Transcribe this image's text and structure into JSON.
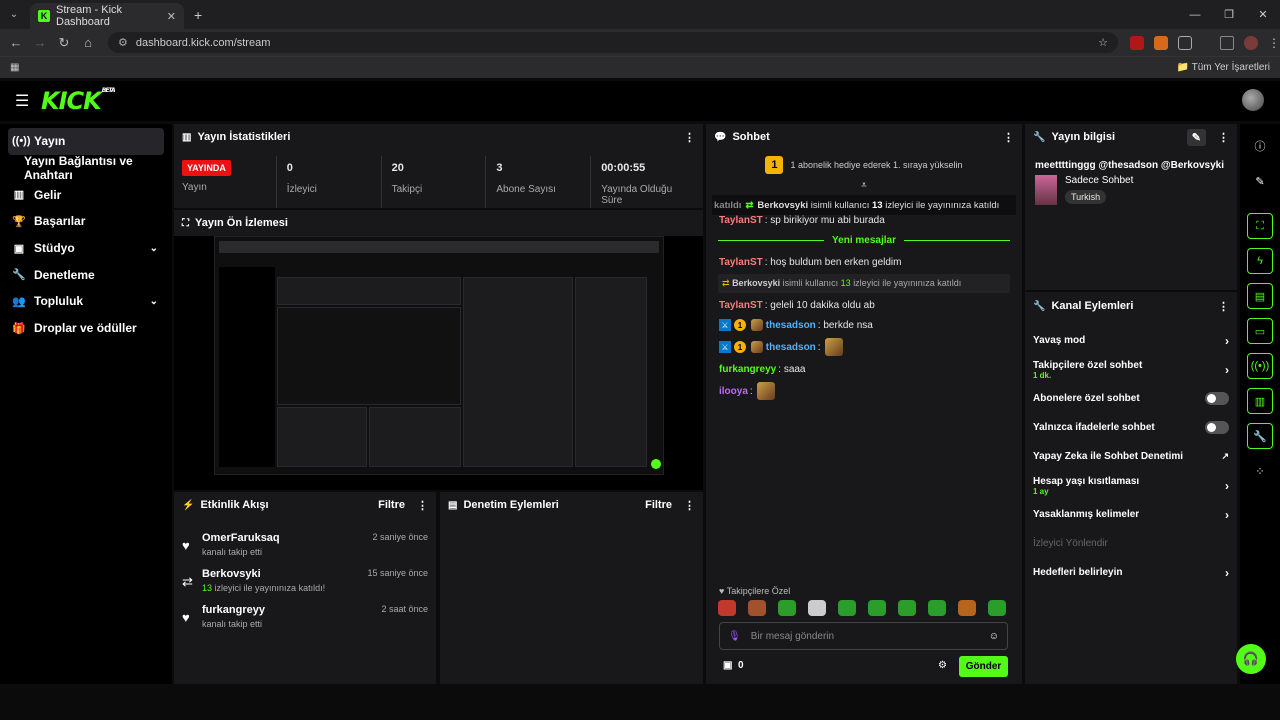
{
  "browser": {
    "tab_title": "Stream - Kick Dashboard",
    "url": "dashboard.kick.com/stream",
    "bookmarks_label": "Tüm Yer İşaretleri"
  },
  "app": {
    "logo": "KICK",
    "logo_badge": "BETA"
  },
  "sidebar": {
    "items": [
      {
        "label": "Yayın",
        "icon": "stream-icon"
      },
      {
        "label": "Yayın Bağlantısı ve Anahtarı"
      },
      {
        "label": "Gelir",
        "icon": "revenue-icon"
      },
      {
        "label": "Başarılar",
        "icon": "trophy-icon"
      },
      {
        "label": "Stüdyo",
        "icon": "studio-icon"
      },
      {
        "label": "Denetleme",
        "icon": "wrench-icon"
      },
      {
        "label": "Topluluk",
        "icon": "community-icon"
      },
      {
        "label": "Droplar ve ödüller",
        "icon": "gift-icon"
      }
    ]
  },
  "stats_panel": {
    "title": "Yayın İstatistikleri",
    "live_badge": "YAYINDA",
    "live_label": "Yayın",
    "viewers": {
      "value": "0",
      "label": "İzleyici"
    },
    "followers": {
      "value": "20",
      "label": "Takipçi"
    },
    "subs": {
      "value": "3",
      "label": "Abone Sayısı"
    },
    "uptime": {
      "value": "00:00:55",
      "label": "Yayında Olduğu Süre"
    }
  },
  "preview_panel": {
    "title": "Yayın Ön İzlemesi"
  },
  "activity_panel": {
    "title": "Etkinlik Akışı",
    "filter": "Filtre",
    "events": [
      {
        "user": "OmerFaruksaq",
        "text": "kanalı takip etti",
        "time": "2 saniye önce",
        "icon": "heart-icon"
      },
      {
        "user": "Berkovsyki",
        "count": "13",
        "text": "izleyici ile yayınınıza katıldı!",
        "time": "15 saniye önce",
        "icon": "raid-icon"
      },
      {
        "user": "furkangreyy",
        "text": "kanalı takip etti",
        "time": "2 saat önce",
        "icon": "heart-icon"
      }
    ]
  },
  "mod_panel": {
    "title": "Denetim Eylemleri",
    "filter": "Filtre"
  },
  "chat": {
    "title": "Sohbet",
    "gift_prompt": "1 abonelik hediye ederek 1. sıraya yükselin",
    "ticker": {
      "prefix": "katıldı",
      "user": "Berkovsyki",
      "mid": "isimli kullanıcı",
      "count": "13",
      "suffix": "izleyici ile yayınınıza katıldı"
    },
    "partial_line": {
      "user": "TaylanST",
      "text": "sp birikiyor mu abi burada"
    },
    "new_messages": "Yeni mesajlar",
    "messages": [
      {
        "user": "TaylanST",
        "text": "hoş buldum ben erken geldim",
        "color": "#ff7b7b"
      },
      {
        "user": "TaylanST",
        "text": "geleli 10 dakika oldu ab",
        "color": "#ff7b7b"
      },
      {
        "user": "thesadson",
        "text": "berkde nsa",
        "color": "#4fb3ff"
      },
      {
        "user": "thesadson",
        "text": "",
        "color": "#4fb3ff"
      },
      {
        "user": "furkangreyy",
        "text": "saaa",
        "color": "#53fc18"
      },
      {
        "user": "ilooya",
        "text": "",
        "color": "#b86bff"
      }
    ],
    "join_notice": {
      "user": "Berkovsyki",
      "mid": "isimli kullanıcı",
      "count": "13",
      "suffix": "izleyici ile yayınınıza katıldı"
    },
    "mode_label": "Takipçilere Özel",
    "input_placeholder": "Bir mesaj gönderin",
    "points": "0",
    "send": "Gönder"
  },
  "info_panel": {
    "title": "Yayın bilgisi",
    "stream_title": "meettttinggg @thesadson @Berkovsyki",
    "category": "Sadece Sohbet",
    "tag": "Turkish"
  },
  "actions_panel": {
    "title": "Kanal Eylemleri",
    "items": [
      {
        "label": "Yavaş mod",
        "type": "chevron"
      },
      {
        "label": "Takipçilere özel sohbet",
        "sub": "1 dk.",
        "type": "chevron"
      },
      {
        "label": "Abonelere özel sohbet",
        "type": "toggle"
      },
      {
        "label": "Yalnızca ifadelerle sohbet",
        "type": "toggle"
      },
      {
        "label": "Yapay Zeka ile Sohbet Denetimi",
        "type": "external"
      },
      {
        "label": "Hesap yaşı kısıtlaması",
        "sub": "1 ay",
        "type": "chevron"
      },
      {
        "label": "Yasaklanmış kelimeler",
        "type": "chevron"
      },
      {
        "label": "İzleyici Yönlendir",
        "type": "disabled"
      },
      {
        "label": "Hedefleri belirleyin",
        "type": "chevron"
      }
    ]
  }
}
